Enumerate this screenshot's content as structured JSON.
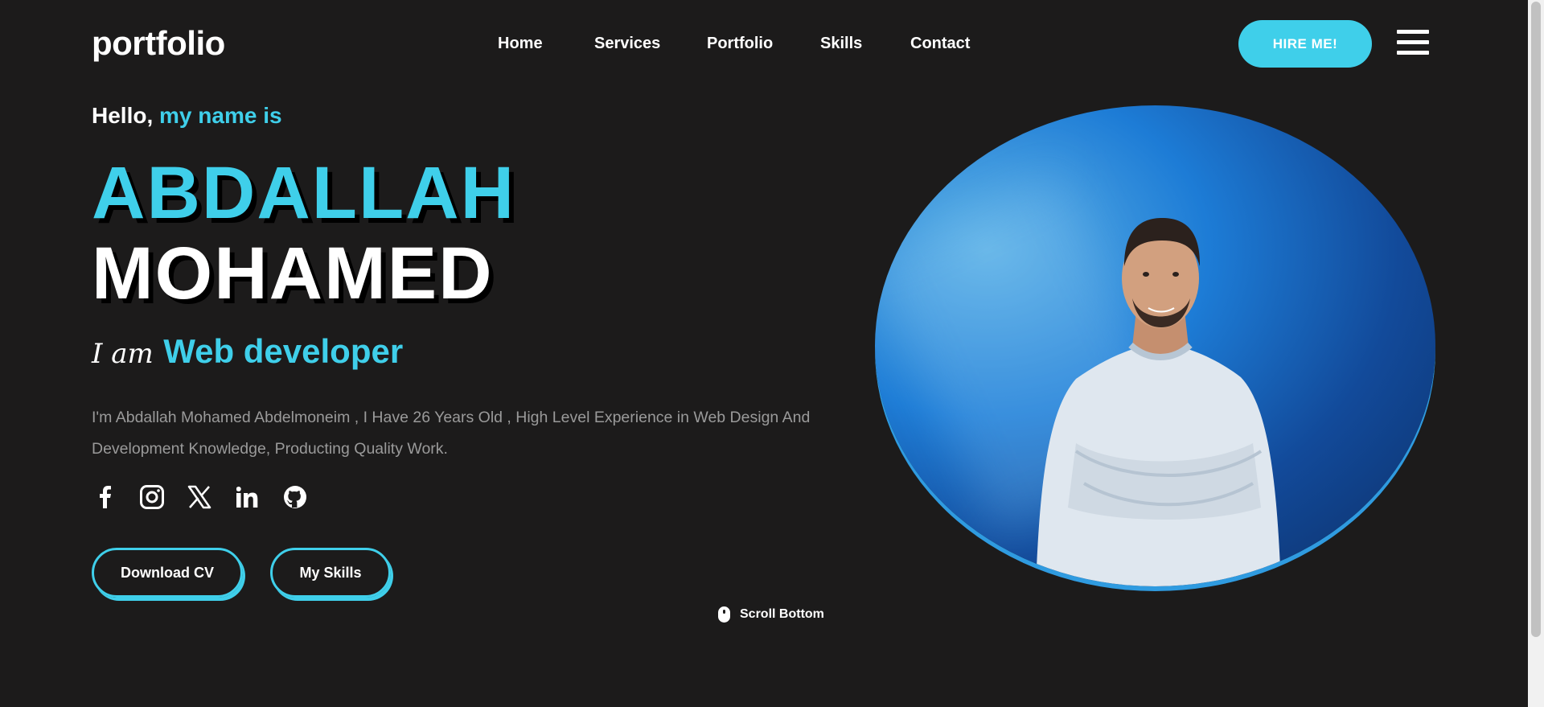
{
  "header": {
    "logo": "portfolio",
    "nav": [
      "Home",
      "Services",
      "Portfolio",
      "Skills",
      "Contact"
    ],
    "hire_label": "HIRE ME!",
    "menu_icon": "hamburger-menu-icon"
  },
  "hero": {
    "greeting_hello": "Hello,",
    "greeting_rest": "my name is",
    "first_name": "ABDALLAH",
    "last_name": "MOHAMED",
    "role_prefix": "I am",
    "role_title": "Web developer",
    "bio": "I'm Abdallah Mohamed Abdelmoneim , I Have 26 Years Old , High Level Experience in Web Design And Development Knowledge, Producting Quality Work.",
    "socials": [
      "facebook-icon",
      "instagram-icon",
      "x-twitter-icon",
      "linkedin-icon",
      "github-icon"
    ],
    "buttons": {
      "download_cv": "Download CV",
      "my_skills": "My Skills"
    },
    "scroll_label": "Scroll Bottom"
  },
  "colors": {
    "accent": "#3fcfea",
    "background": "#1c1b1b",
    "muted_text": "#9a9a9a"
  }
}
